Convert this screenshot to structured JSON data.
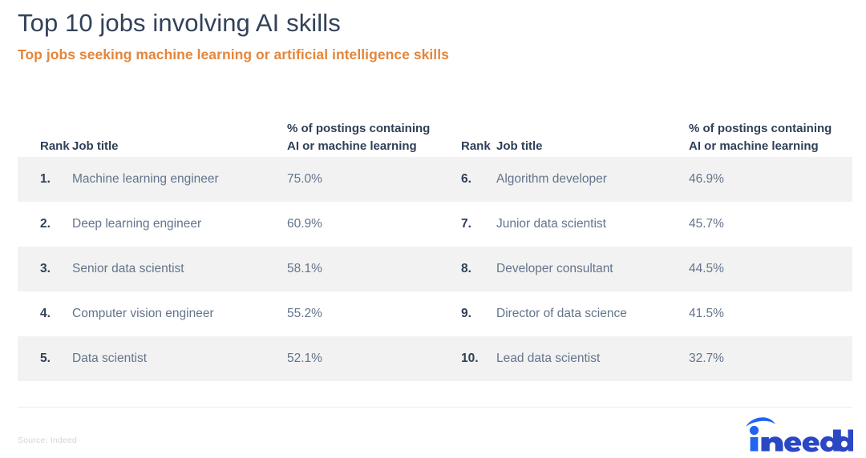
{
  "header": {
    "title": "Top 10 jobs involving AI skills",
    "subtitle": "Top jobs seeking machine learning or artificial intelligence skills"
  },
  "columns": {
    "rank": "Rank",
    "job_title": "Job title",
    "percent": "% of postings containing AI or machine learning"
  },
  "footer": {
    "source": "Source: Indeed",
    "logo_text": "indeed"
  },
  "colors": {
    "title": "#33415a",
    "subtitle": "#e4863b",
    "body_text": "#64748b",
    "rank_text": "#2f4057",
    "row_stripe": "#f2f2f2",
    "logo_blue": "#2164f3",
    "logo_dark": "#2f3ea8"
  },
  "chart_data": {
    "type": "table",
    "title": "Top 10 jobs involving AI skills",
    "subtitle": "Top jobs seeking machine learning or artificial intelligence skills",
    "columns": [
      "Rank",
      "Job title",
      "% of postings containing AI or machine learning"
    ],
    "ylabel": "% of postings containing AI or machine learning",
    "xlabel": "Job title",
    "categories": [
      "Machine learning engineer",
      "Deep learning engineer",
      "Senior data scientist",
      "Computer vision engineer",
      "Data scientist",
      "Algorithm developer",
      "Junior data scientist",
      "Developer consultant",
      "Director of data science",
      "Lead data scientist"
    ],
    "values": [
      75.0,
      60.9,
      58.1,
      55.2,
      52.1,
      46.9,
      45.7,
      44.5,
      41.5,
      32.7
    ],
    "rows_left": [
      {
        "rank": "1.",
        "job": "Machine learning engineer",
        "pct": "75.0%"
      },
      {
        "rank": "2.",
        "job": "Deep learning engineer",
        "pct": "60.9%"
      },
      {
        "rank": "3.",
        "job": "Senior data scientist",
        "pct": "58.1%"
      },
      {
        "rank": "4.",
        "job": "Computer vision engineer",
        "pct": "55.2%"
      },
      {
        "rank": "5.",
        "job": "Data scientist",
        "pct": "52.1%"
      }
    ],
    "rows_right": [
      {
        "rank": "6.",
        "job": "Algorithm developer",
        "pct": "46.9%"
      },
      {
        "rank": "7.",
        "job": "Junior data scientist",
        "pct": "45.7%"
      },
      {
        "rank": "8.",
        "job": "Developer consultant",
        "pct": "44.5%"
      },
      {
        "rank": "9.",
        "job": "Director of data science",
        "pct": "41.5%"
      },
      {
        "rank": "10.",
        "job": "Lead data scientist",
        "pct": "32.7%"
      }
    ],
    "source": "Source: Indeed"
  }
}
